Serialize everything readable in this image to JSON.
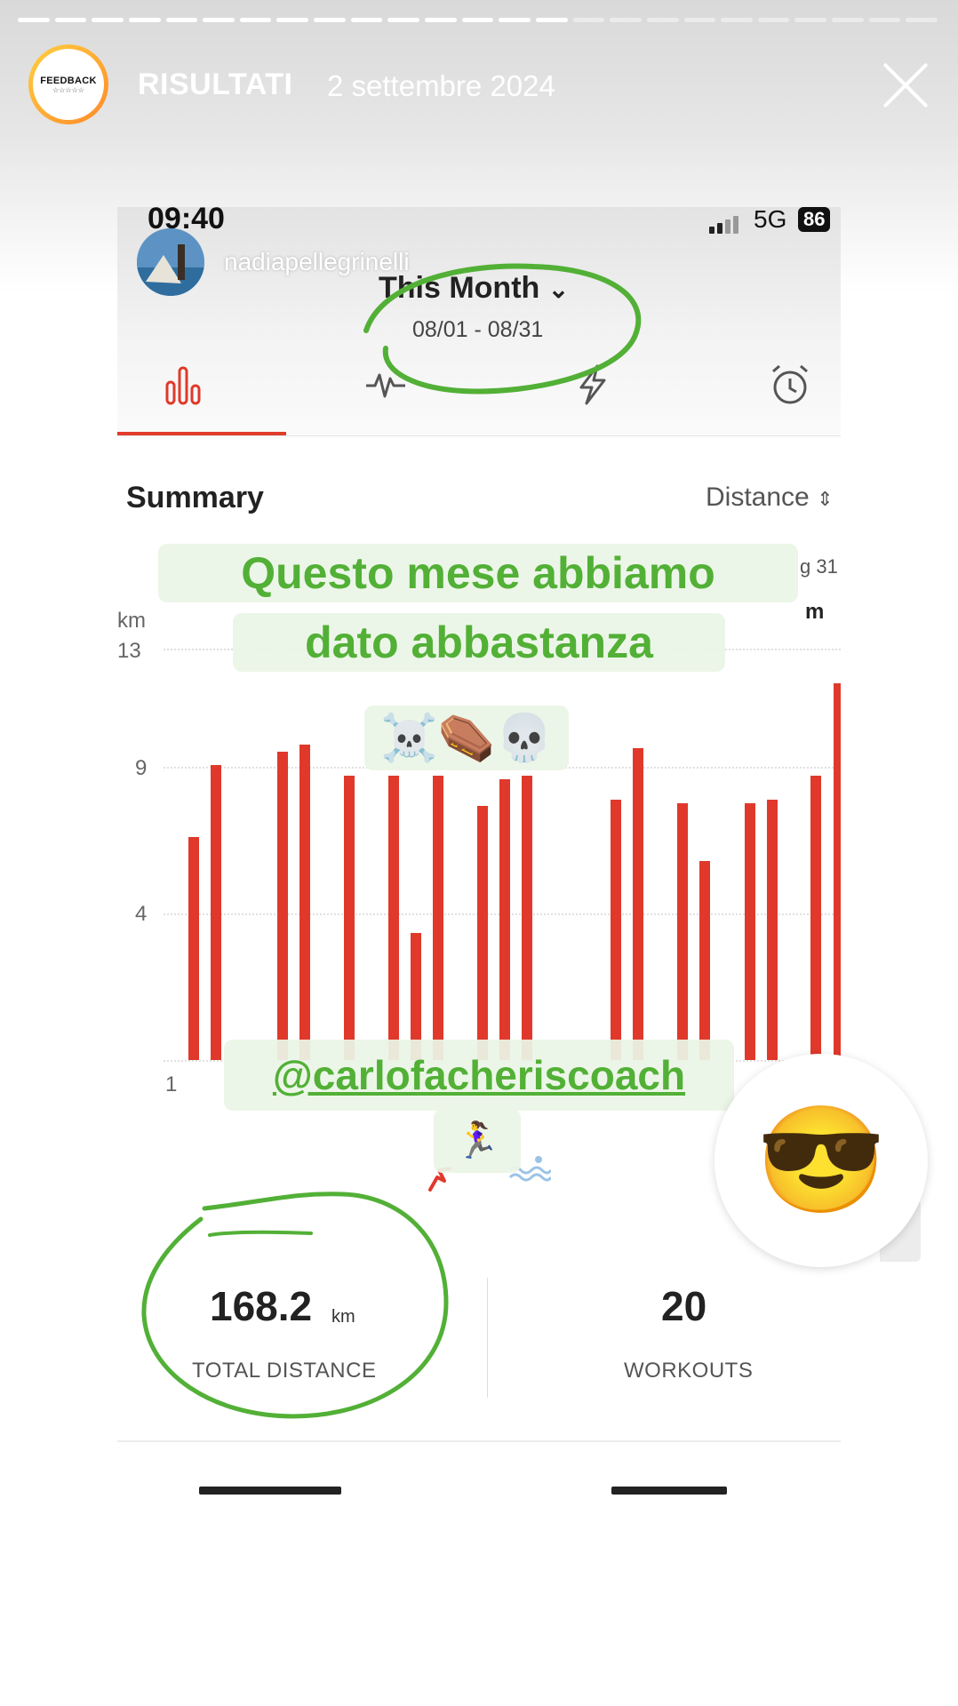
{
  "story": {
    "title": "RISULTATI",
    "date": "2 settembre 2024",
    "avatar_text": "FEEDBACK",
    "avatar_stars": "☆☆☆☆☆",
    "progress_done": 0.61
  },
  "screenshot": {
    "status": {
      "time": "09:40",
      "network": "5G",
      "battery": "86"
    },
    "username": "nadiapellegrinelli",
    "period": {
      "title": "This Month",
      "chevron": "⌄",
      "range": "08/01 - 08/31"
    },
    "tabs": [
      {
        "icon": "bar-chart-icon"
      },
      {
        "icon": "heartbeat-icon"
      },
      {
        "icon": "lightning-icon"
      },
      {
        "icon": "alarm-clock-icon"
      }
    ],
    "summary_label": "Summary",
    "metric_selector": "Distance",
    "metric_selector_arrow": "⌃⌄",
    "side_fragments": {
      "date": "g 31",
      "unit": "m"
    },
    "stats": [
      {
        "value": "168.2",
        "unit": "km",
        "label": "TOTAL DISTANCE"
      },
      {
        "value": "20",
        "unit": "",
        "label": "WORKOUTS"
      }
    ]
  },
  "chart_data": {
    "type": "bar",
    "ylabel": "km",
    "y_ticks": [
      "13",
      "9",
      "4",
      "1"
    ],
    "ylim": [
      1,
      13
    ],
    "values": [
      7.5,
      9.6,
      10.0,
      10.2,
      9.3,
      9.3,
      4.7,
      9.3,
      8.4,
      9.2,
      9.3,
      8.6,
      10.1,
      8.5,
      6.8,
      8.5,
      8.6,
      9.3,
      12.0
    ],
    "legend_icons": [
      "running-icon",
      "swimming-icon"
    ],
    "colors": {
      "bar": "#e0392b"
    }
  },
  "overlay": {
    "caption_line1": "Questo mese abbiamo",
    "caption_line2": "dato abbastanza",
    "caption_emojis": "☠️⚰️💀",
    "mention": "@carlofacheriscoach",
    "runner_emoji": "🏃‍♀️",
    "sticker_emoji": "😎",
    "accent_color": "#52b036"
  }
}
